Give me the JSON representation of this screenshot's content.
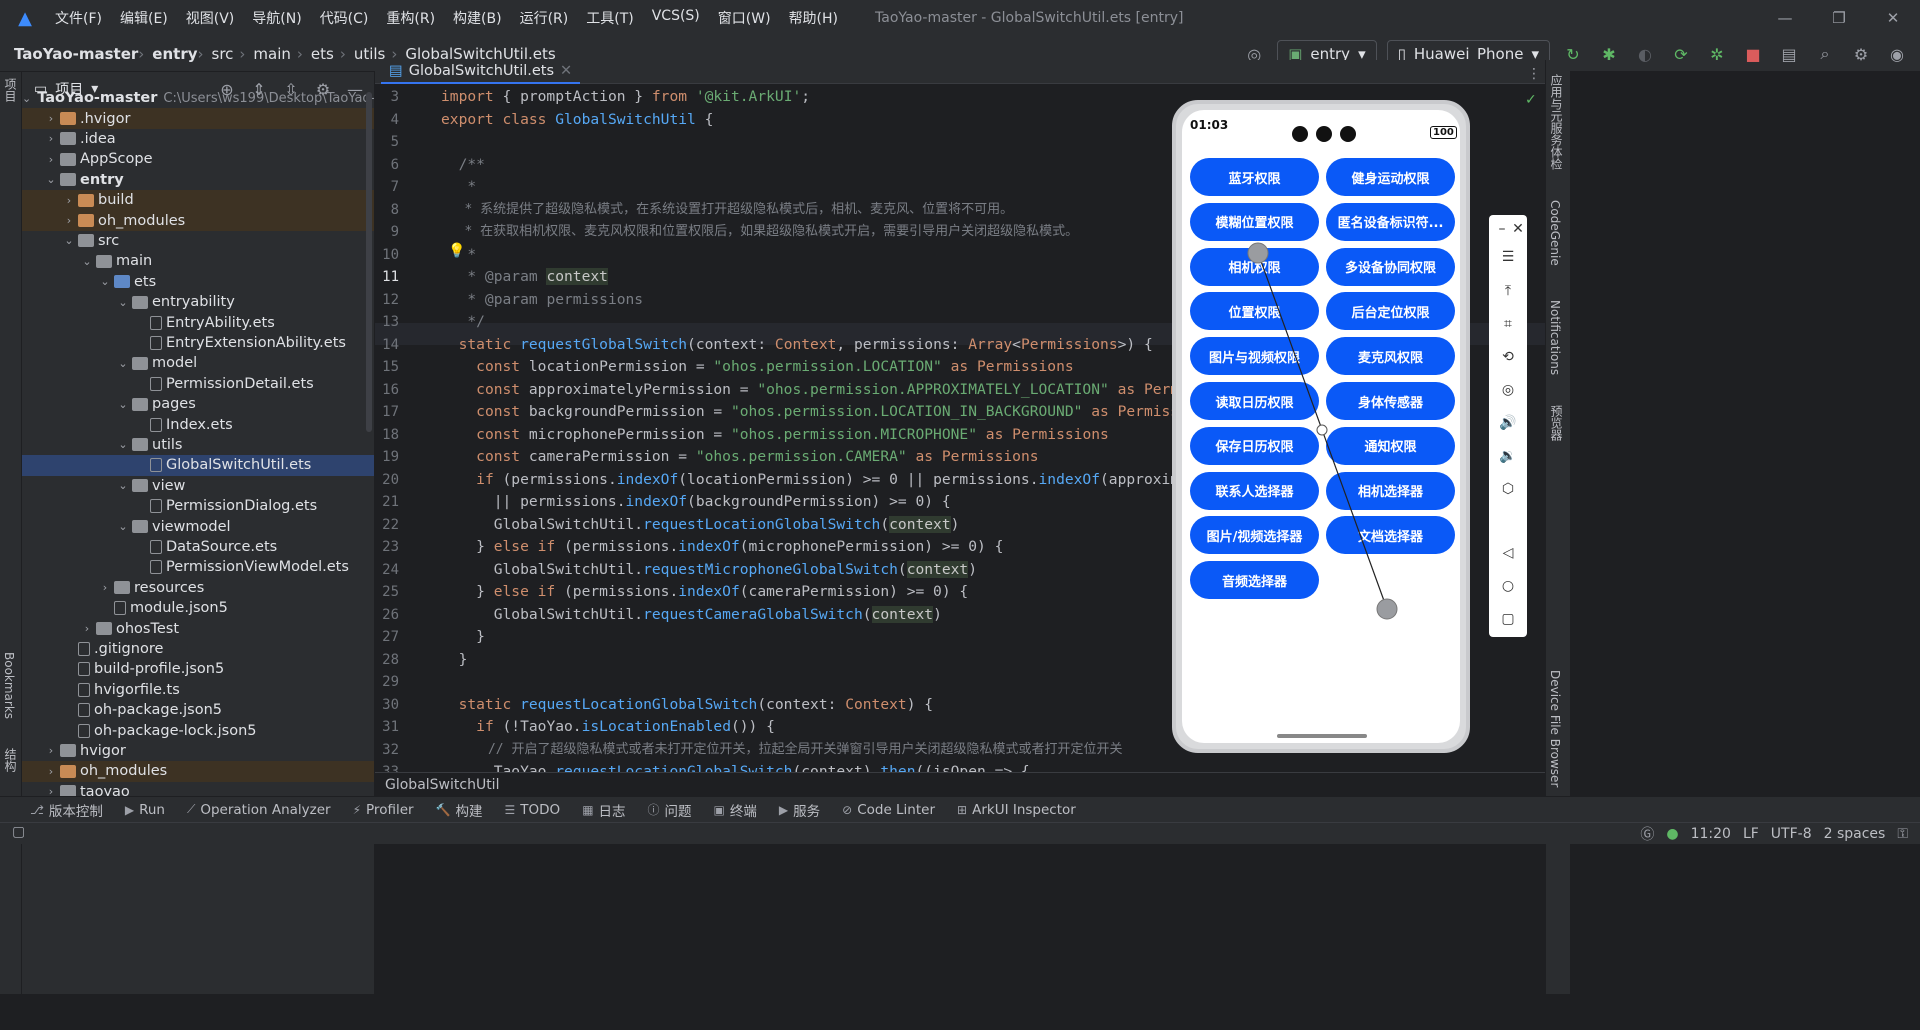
{
  "titlebar": {
    "menus": [
      "文件(F)",
      "编辑(E)",
      "视图(V)",
      "导航(N)",
      "代码(C)",
      "重构(R)",
      "构建(B)",
      "运行(R)",
      "工具(T)",
      "VCS(S)",
      "窗口(W)",
      "帮助(H)"
    ],
    "window_title": "TaoYao-master - GlobalSwitchUtil.ets [entry]"
  },
  "breadcrumb": [
    "TaoYao-master",
    "entry",
    "src",
    "main",
    "ets",
    "utils",
    "GlobalSwitchUtil.ets"
  ],
  "toolbar": {
    "module": "entry",
    "device": "Huawei_Phone"
  },
  "project": {
    "title": "项目",
    "root": "TaoYao-master",
    "root_path": "C:\\Users\\ws199\\Desktop\\TaoYao-m",
    "tree": [
      {
        "label": ".hvigor",
        "depth": 1,
        "kind": "folder-o",
        "arrow": "›"
      },
      {
        "label": ".idea",
        "depth": 1,
        "kind": "folder",
        "arrow": "›"
      },
      {
        "label": "AppScope",
        "depth": 1,
        "kind": "folder",
        "arrow": "›"
      },
      {
        "label": "entry",
        "depth": 1,
        "kind": "folder",
        "arrow": "⌄",
        "bold": true
      },
      {
        "label": "build",
        "depth": 2,
        "kind": "folder-o",
        "arrow": "›"
      },
      {
        "label": "oh_modules",
        "depth": 2,
        "kind": "folder-o",
        "arrow": "›"
      },
      {
        "label": "src",
        "depth": 2,
        "kind": "folder",
        "arrow": "⌄"
      },
      {
        "label": "main",
        "depth": 3,
        "kind": "folder",
        "arrow": "⌄"
      },
      {
        "label": "ets",
        "depth": 4,
        "kind": "folder-b",
        "arrow": "⌄"
      },
      {
        "label": "entryability",
        "depth": 5,
        "kind": "folder",
        "arrow": "⌄"
      },
      {
        "label": "EntryAbility.ets",
        "depth": 6,
        "kind": "file"
      },
      {
        "label": "EntryExtensionAbility.ets",
        "depth": 6,
        "kind": "file"
      },
      {
        "label": "model",
        "depth": 5,
        "kind": "folder",
        "arrow": "⌄"
      },
      {
        "label": "PermissionDetail.ets",
        "depth": 6,
        "kind": "file"
      },
      {
        "label": "pages",
        "depth": 5,
        "kind": "folder",
        "arrow": "⌄"
      },
      {
        "label": "Index.ets",
        "depth": 6,
        "kind": "file"
      },
      {
        "label": "utils",
        "depth": 5,
        "kind": "folder",
        "arrow": "⌄"
      },
      {
        "label": "GlobalSwitchUtil.ets",
        "depth": 6,
        "kind": "file",
        "sel": true
      },
      {
        "label": "view",
        "depth": 5,
        "kind": "folder",
        "arrow": "⌄"
      },
      {
        "label": "PermissionDialog.ets",
        "depth": 6,
        "kind": "file"
      },
      {
        "label": "viewmodel",
        "depth": 5,
        "kind": "folder",
        "arrow": "⌄"
      },
      {
        "label": "DataSource.ets",
        "depth": 6,
        "kind": "file"
      },
      {
        "label": "PermissionViewModel.ets",
        "depth": 6,
        "kind": "file"
      },
      {
        "label": "resources",
        "depth": 4,
        "kind": "folder",
        "arrow": "›"
      },
      {
        "label": "module.json5",
        "depth": 4,
        "kind": "file"
      },
      {
        "label": "ohosTest",
        "depth": 3,
        "kind": "folder",
        "arrow": "›"
      },
      {
        "label": ".gitignore",
        "depth": 2,
        "kind": "file"
      },
      {
        "label": "build-profile.json5",
        "depth": 2,
        "kind": "file"
      },
      {
        "label": "hvigorfile.ts",
        "depth": 2,
        "kind": "file"
      },
      {
        "label": "oh-package.json5",
        "depth": 2,
        "kind": "file"
      },
      {
        "label": "oh-package-lock.json5",
        "depth": 2,
        "kind": "file"
      },
      {
        "label": "hvigor",
        "depth": 1,
        "kind": "folder",
        "arrow": "›"
      },
      {
        "label": "oh_modules",
        "depth": 1,
        "kind": "folder-o",
        "arrow": "›"
      },
      {
        "label": "taoyao",
        "depth": 1,
        "kind": "folder",
        "arrow": "›"
      }
    ]
  },
  "editor": {
    "tab": "GlobalSwitchUtil.ets",
    "footer": "GlobalSwitchUtil",
    "line_numbers": [
      "3",
      "4",
      "5",
      "6",
      "7",
      "8",
      "9",
      "10",
      "11",
      "12",
      "13",
      "14",
      "15",
      "16",
      "17",
      "18",
      "19",
      "20",
      "21",
      "22",
      "23",
      "24",
      "25",
      "26",
      "27",
      "28",
      "29",
      "30",
      "31",
      "32",
      "33"
    ]
  },
  "phone": {
    "time": "01:03",
    "battery": "100",
    "buttons": [
      "蓝牙权限",
      "健身运动权限",
      "模糊位置权限",
      "匿名设备标识符...",
      "相机权限",
      "多设备协同权限",
      "位置权限",
      "后台定位权限",
      "图片与视频权限",
      "麦克风权限",
      "读取日历权限",
      "身体传感器",
      "保存日历权限",
      "通知权限",
      "联系人选择器",
      "相机选择器",
      "图片/视频选择器",
      "文档选择器",
      "音频选择器"
    ]
  },
  "right_tools": [
    "应用与元服务体检",
    "CodeGenie",
    "Notifications",
    "预览器",
    "Device File Browser"
  ],
  "left_tools": [
    "项目",
    "Bookmarks",
    "结构"
  ],
  "tool_windows": [
    "版本控制",
    "Run",
    "Operation Analyzer",
    "Profiler",
    "构建",
    "TODO",
    "日志",
    "问题",
    "终端",
    "服务",
    "Code Linter",
    "ArkUI Inspector"
  ],
  "status": {
    "time": "11:20",
    "line_sep": "LF",
    "encoding": "UTF-8",
    "indent": "2 spaces"
  }
}
